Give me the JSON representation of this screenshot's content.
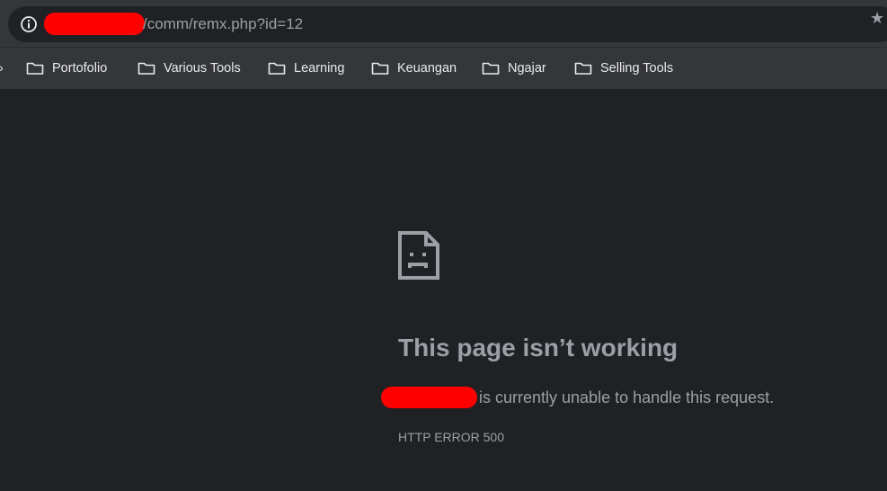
{
  "address_bar": {
    "url_path": "/comm/remx.php?id=12",
    "icons": {
      "site_info": "info-icon",
      "bookmark_star": "star-icon"
    }
  },
  "bookmarks": [
    {
      "label": "Portofolio",
      "icon": "folder-icon"
    },
    {
      "label": "Various Tools",
      "icon": "folder-icon"
    },
    {
      "label": "Learning",
      "icon": "folder-icon"
    },
    {
      "label": "Keuangan",
      "icon": "folder-icon"
    },
    {
      "label": "Ngajar",
      "icon": "folder-icon"
    },
    {
      "label": "Selling Tools",
      "icon": "folder-icon"
    }
  ],
  "error_page": {
    "icon": "sad-page-icon",
    "heading": "This page isn’t working",
    "message": "is currently unable to handle this request.",
    "code": "HTTP ERROR 500"
  },
  "colors": {
    "page_background": "#202124",
    "toolbar": "#35363a",
    "text_muted": "#9aa0a6",
    "text_light": "#e8eaed",
    "redaction": "#ff0000"
  }
}
